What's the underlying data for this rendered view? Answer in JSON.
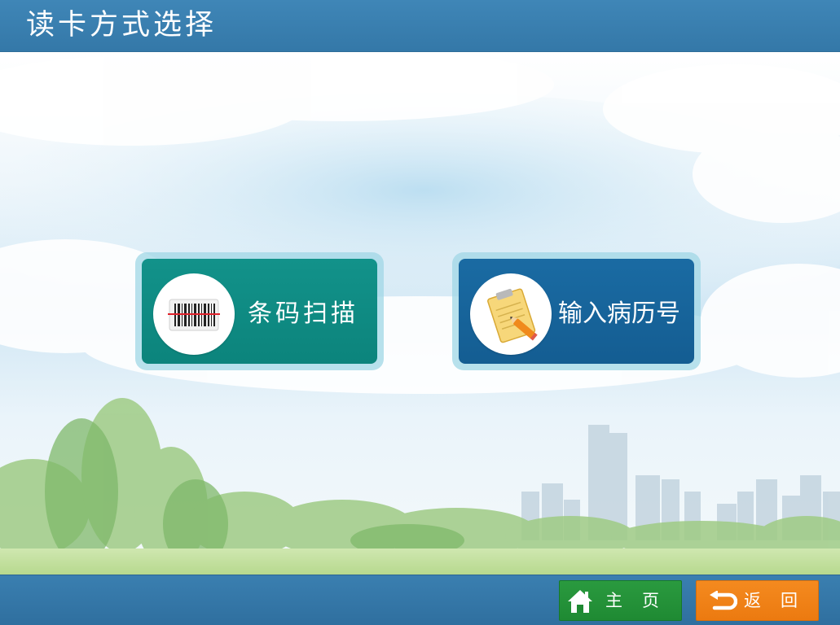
{
  "header": {
    "title": "读卡方式选择"
  },
  "options": {
    "barcode": {
      "label": "条码扫描",
      "icon": "barcode-scanner-icon"
    },
    "history": {
      "label": "输入病历号",
      "icon": "clipboard-pencil-icon"
    }
  },
  "footer": {
    "home_label": "主页",
    "home_icon": "home-icon",
    "back_label": "返回",
    "back_icon": "return-arrow-icon"
  },
  "colors": {
    "header_bar": "#3478a8",
    "barcode_card": "#0c847c",
    "history_card": "#145d92",
    "home_button": "#1f8a33",
    "back_button": "#ec7a10"
  }
}
